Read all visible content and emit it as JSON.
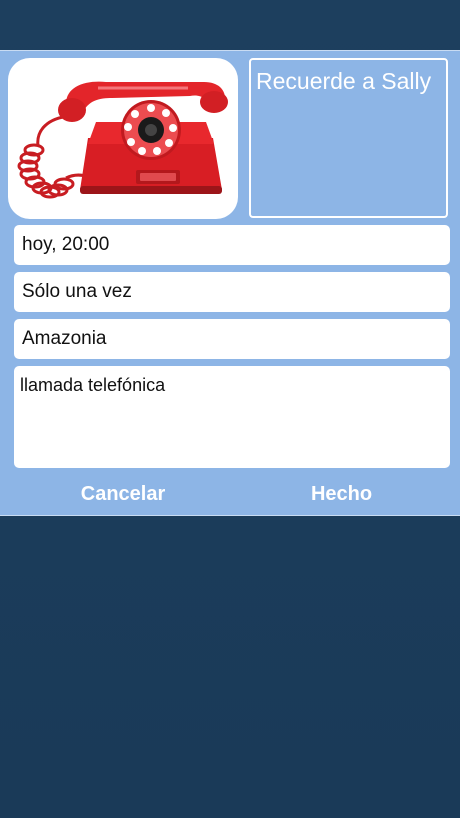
{
  "reminder": {
    "title": "Recuerde a Sally",
    "image_icon": "red-rotary-phone-image",
    "datetime": "hoy, 20:00",
    "repeat": "Sólo una vez",
    "location": "Amazonia",
    "notes": "llamada telefónica"
  },
  "actions": {
    "cancel_label": "Cancelar",
    "done_label": "Hecho"
  },
  "colors": {
    "background": "#1c3d5c",
    "panel": "#8db5e6",
    "phone_red": "#e5262b"
  }
}
